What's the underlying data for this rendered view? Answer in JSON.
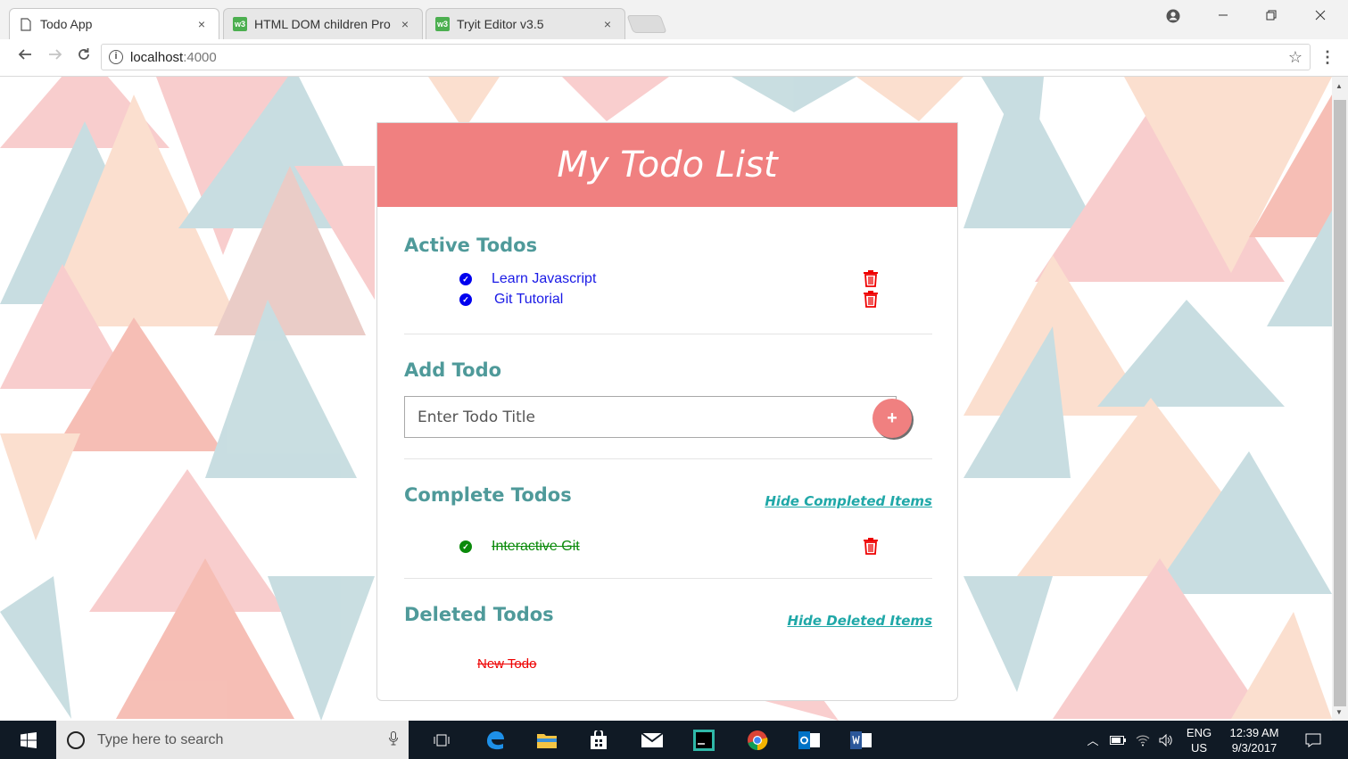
{
  "browser": {
    "tabs": [
      {
        "title": "Todo App",
        "active": true,
        "favicon": "page-icon"
      },
      {
        "title": "HTML DOM children Pro",
        "active": false,
        "favicon": "w3-icon"
      },
      {
        "title": "Tryit Editor v3.5",
        "active": false,
        "favicon": "w3-icon"
      }
    ],
    "close_glyph": "×",
    "address": {
      "host": "localhost",
      "port": ":4000"
    }
  },
  "app": {
    "title": "My Todo List",
    "active_section": {
      "heading": "Active Todos",
      "items": [
        {
          "text": "Learn Javascript"
        },
        {
          "text": "Git Tutorial"
        }
      ]
    },
    "add_section": {
      "heading": "Add Todo",
      "placeholder": "Enter Todo Title",
      "button_label": "+"
    },
    "complete_section": {
      "heading": "Complete Todos",
      "hide_link": "Hide Completed Items",
      "items": [
        {
          "text": "Interactive Git"
        }
      ]
    },
    "deleted_section": {
      "heading": "Deleted Todos",
      "hide_link": "Hide Deleted Items",
      "items": [
        {
          "text": "New Todo"
        }
      ]
    },
    "colors": {
      "header": "#f08080",
      "heading": "#4f9a9a",
      "active_text": "#1a1ae6",
      "complete_text": "#0a8a0a",
      "deleted_text": "#e00000",
      "link": "#20a8a8"
    }
  },
  "taskbar": {
    "search_placeholder": "Type here to search",
    "language": "ENG",
    "region": "US",
    "time": "12:39 AM",
    "date": "9/3/2017"
  }
}
